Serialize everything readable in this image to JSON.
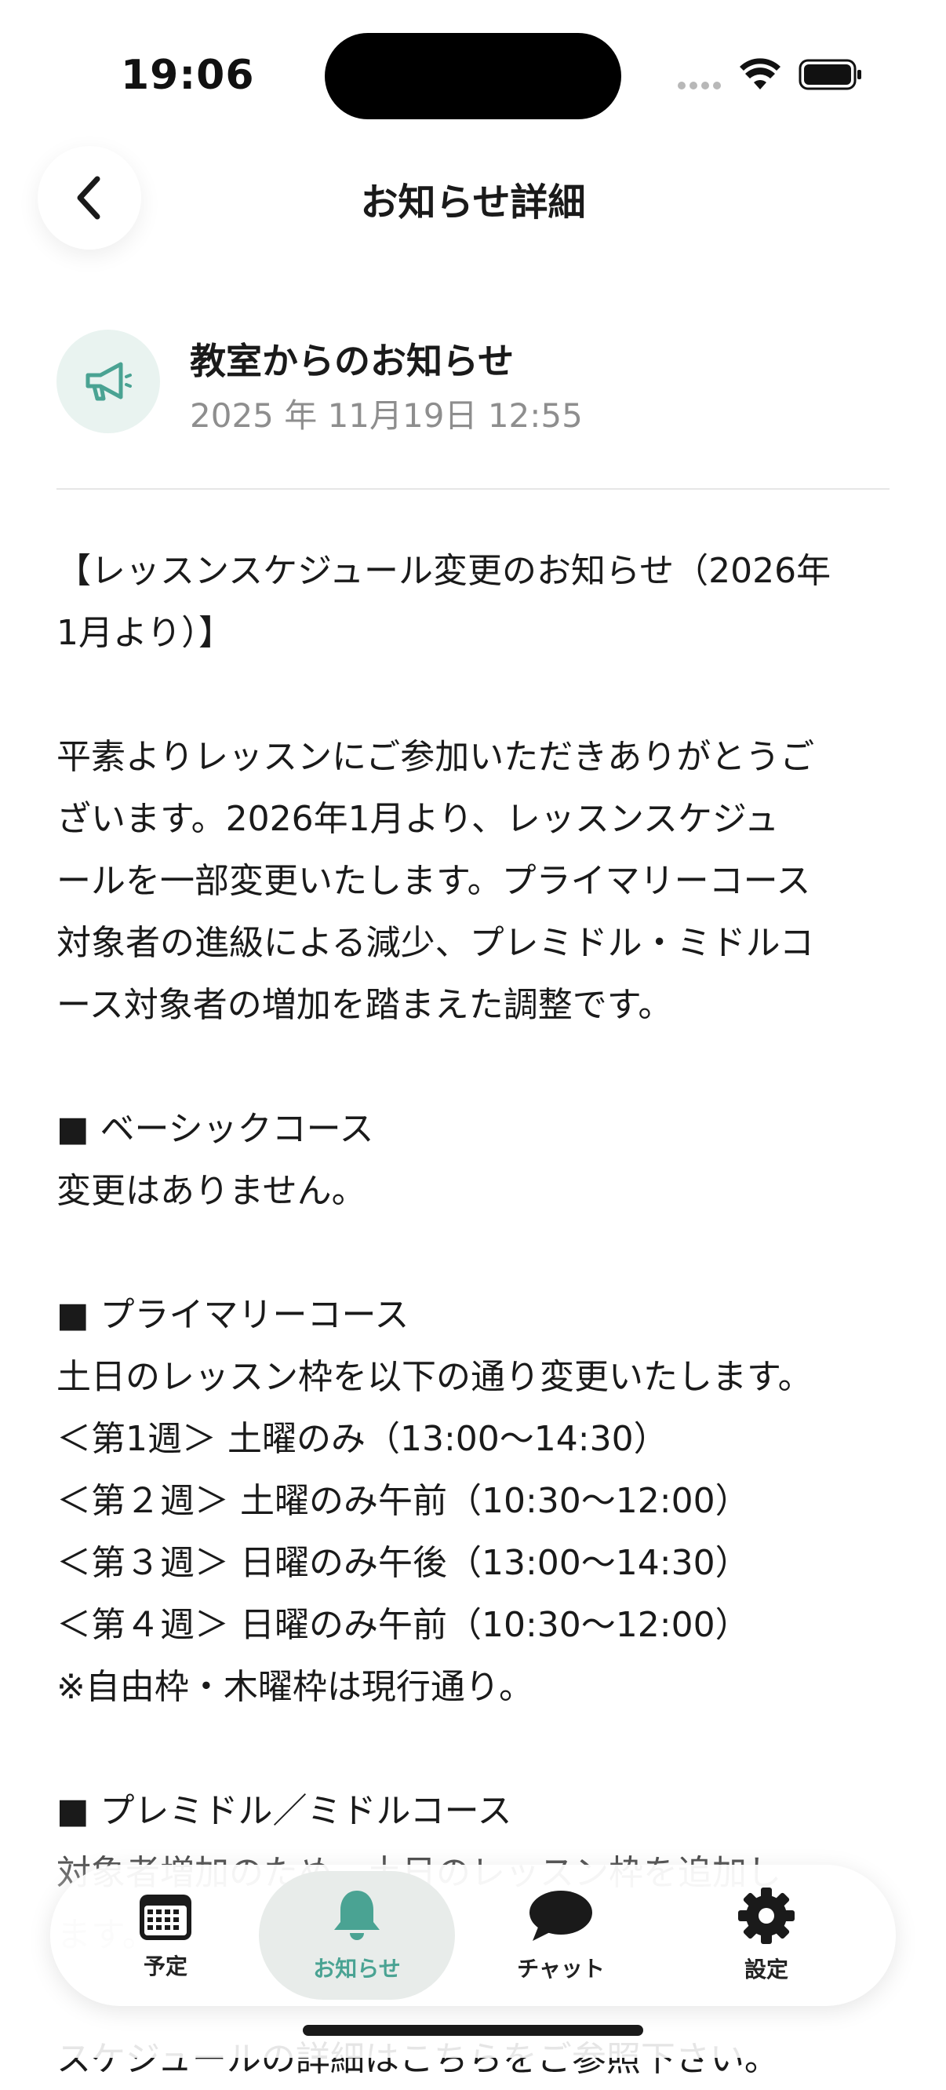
{
  "status_bar": {
    "time": "19:06"
  },
  "header": {
    "title": "お知らせ詳細",
    "back_icon": "chevron-left-icon"
  },
  "notice": {
    "sender": "教室からのお知らせ",
    "date": "2025 年 11月19日 12:55",
    "icon": "megaphone-icon",
    "lines": [
      "【レッスンスケジュール変更のお知らせ（2026年",
      "1月より）】",
      "",
      "平素よりレッスンにご参加いただきありがとうご",
      "ざいます。2026年1月より、レッスンスケジュ",
      "ールを一部変更いたします。プライマリーコース",
      "対象者の進級による減少、プレミドル・ミドルコ",
      "ース対象者の増加を踏まえた調整です。",
      "",
      "■ ベーシックコース",
      "変更はありません。",
      "",
      "■ プライマリーコース",
      "土日のレッスン枠を以下の通り変更いたします。",
      "＜第1週＞ 土曜のみ（13:00〜14:30）",
      "＜第２週＞ 土曜のみ午前（10:30〜12:00）",
      "＜第３週＞ 日曜のみ午後（13:00〜14:30）",
      "＜第４週＞ 日曜のみ午前（10:30〜12:00）",
      "※自由枠・木曜枠は現行通り。",
      "",
      "■ プレミドル／ミドルコース",
      "対象者増加のため、土日のレッスン枠を追加し",
      "ます。",
      "",
      "スケジュールの詳細はこちらをご参照下さい。"
    ]
  },
  "tab_bar": {
    "tabs": [
      {
        "label": "予定",
        "icon": "calendar-icon",
        "active": false
      },
      {
        "label": "お知らせ",
        "icon": "bell-icon",
        "active": true
      },
      {
        "label": "チャット",
        "icon": "chat-bubble-icon",
        "active": false
      },
      {
        "label": "設定",
        "icon": "gear-icon",
        "active": false
      }
    ]
  },
  "colors": {
    "accent": "#4aa393",
    "icon_bg": "#e9f3f0",
    "active_tab_bg": "#e8ecea",
    "secondary_text": "#8e8e8e"
  }
}
